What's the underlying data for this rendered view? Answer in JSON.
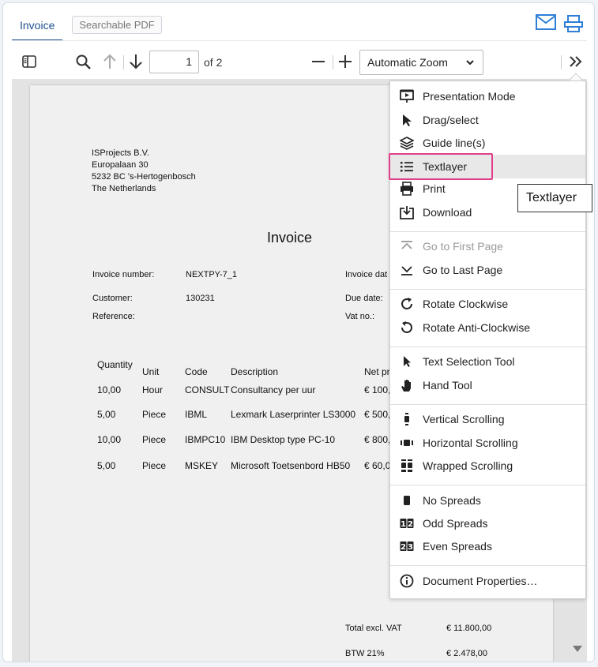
{
  "tabs": {
    "active": "Invoice",
    "secondary": "Searchable PDF"
  },
  "toolbar": {
    "page_number": "1",
    "page_count_label": "of 2",
    "zoom_value": "Automatic Zoom"
  },
  "document": {
    "sender": [
      "ISProjects B.V.",
      "Europalaan 30",
      "5232 BC 's-Hertogenbosch",
      "The Netherlands"
    ],
    "title": "Invoice",
    "fields": {
      "invoice_number_label": "Invoice number:",
      "invoice_number": "NEXTPY-7_1",
      "invoice_date_label": "Invoice dat",
      "customer_label": "Customer:",
      "customer": "130231",
      "due_date_label": "Due date:",
      "reference_label": "Reference:",
      "vat_label": "Vat no.:"
    },
    "table": {
      "headers": [
        "Quantity",
        "Unit",
        "Code",
        "Description",
        "Net pr"
      ],
      "rows": [
        [
          "10,00",
          "Hour",
          "CONSULT",
          "Consultancy per uur",
          "€ 100,"
        ],
        [
          "5,00",
          "Piece",
          "IBML",
          "Lexmark Laserprinter LS3000",
          "€ 500,"
        ],
        [
          "10,00",
          "Piece",
          "IBMPC10",
          "IBM Desktop type PC-10",
          "€ 800,"
        ],
        [
          "5,00",
          "Piece",
          "MSKEY",
          "Microsoft Toetsenbord HB50",
          "€ 60,0"
        ]
      ]
    },
    "totals": [
      {
        "label": "Total excl. VAT",
        "value": "€ 11.800,00"
      },
      {
        "label": "BTW 21%",
        "value": "€ 2.478,00"
      }
    ]
  },
  "menu": {
    "items": [
      {
        "label": "Presentation Mode",
        "icon": "presentation-icon"
      },
      {
        "label": "Drag/select",
        "icon": "cursor-icon"
      },
      {
        "label": "Guide line(s)",
        "icon": "layers-icon"
      },
      {
        "label": "Textlayer",
        "icon": "list-icon"
      },
      {
        "label": "Print",
        "icon": "print-icon"
      },
      {
        "label": "Download",
        "icon": "download-icon"
      },
      {
        "label": "Go to First Page",
        "icon": "first-page-icon"
      },
      {
        "label": "Go to Last Page",
        "icon": "last-page-icon"
      },
      {
        "label": "Rotate Clockwise",
        "icon": "rotate-cw-icon"
      },
      {
        "label": "Rotate Anti-Clockwise",
        "icon": "rotate-ccw-icon"
      },
      {
        "label": "Text Selection Tool",
        "icon": "cursor-icon"
      },
      {
        "label": "Hand Tool",
        "icon": "hand-icon"
      },
      {
        "label": "Vertical Scrolling",
        "icon": "vertical-scroll-icon"
      },
      {
        "label": "Horizontal Scrolling",
        "icon": "horizontal-scroll-icon"
      },
      {
        "label": "Wrapped Scrolling",
        "icon": "wrapped-scroll-icon"
      },
      {
        "label": "No Spreads",
        "icon": "no-spreads-icon"
      },
      {
        "label": "Odd Spreads",
        "icon": "odd-spreads-icon"
      },
      {
        "label": "Even Spreads",
        "icon": "even-spreads-icon"
      },
      {
        "label": "Document Properties…",
        "icon": "info-icon"
      }
    ]
  },
  "tooltip": {
    "text": "Textlayer"
  },
  "colors": {
    "accent": "#1f4f8f",
    "highlight": "#e0408a",
    "icon_blue": "#2f7fd8"
  }
}
